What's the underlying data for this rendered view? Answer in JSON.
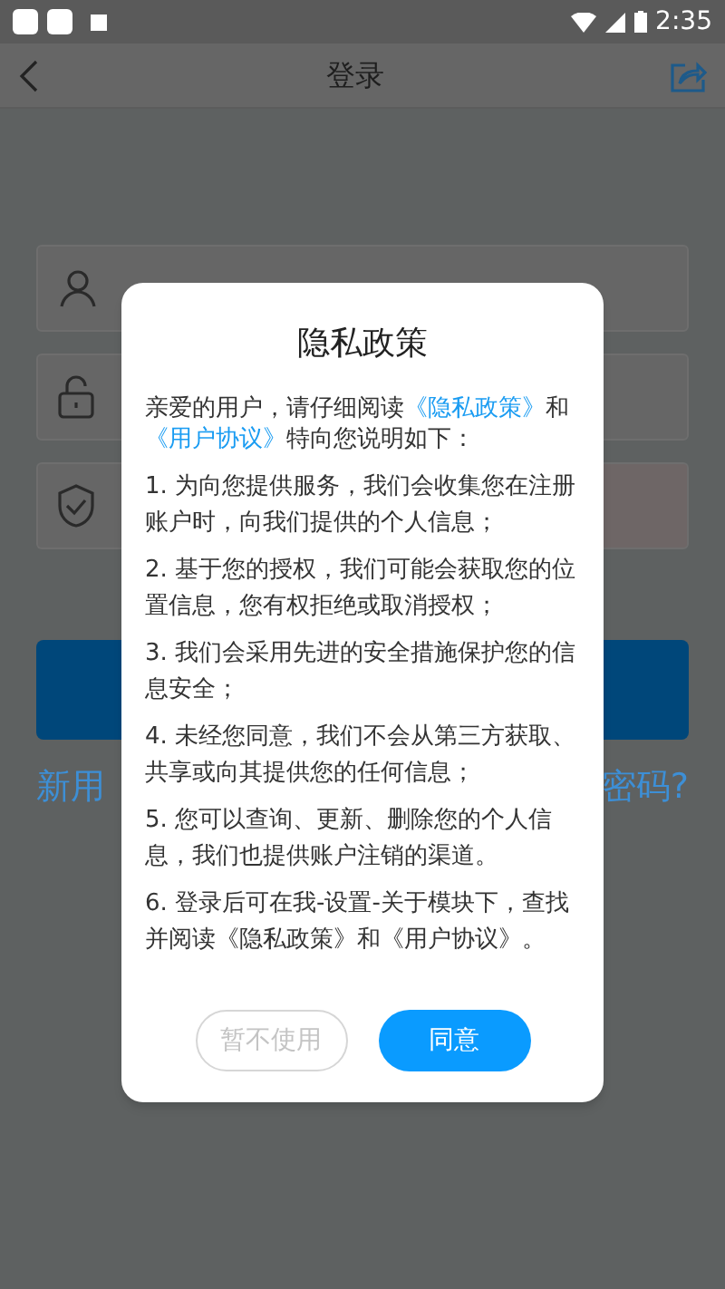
{
  "status_bar": {
    "time": "2:35"
  },
  "header": {
    "title": "登录"
  },
  "form": {
    "fields": [
      {
        "kind": "user"
      },
      {
        "kind": "lock"
      },
      {
        "kind": "captcha"
      }
    ],
    "links": [
      "新用",
      "密码?"
    ]
  },
  "dialog": {
    "title": "隐私政策",
    "intro": [
      {
        "text": "亲爱的用户，请仔细阅读",
        "link": false
      },
      {
        "text": "《隐私政策》",
        "link": true
      },
      {
        "text": "和",
        "link": false
      },
      {
        "text": "《用户协议》",
        "link": true
      },
      {
        "text": "特向您说明如下：",
        "link": false
      }
    ],
    "items": [
      "1. 为向您提供服务，我们会收集您在注册账户时，向我们提供的个人信息；",
      "2. 基于您的授权，我们可能会获取您的位置信息，您有权拒绝或取消授权；",
      "3. 我们会采用先进的安全措施保护您的信息安全；",
      "4. 未经您同意，我们不会从第三方获取、共享或向其提供您的任何信息；",
      "5. 您可以查询、更新、删除您的个人信息，我们也提供账户注销的渠道。",
      "6. 登录后可在我-设置-关于模块下，查找并阅读《隐私政策》和《用户协议》。"
    ],
    "buttons": [
      {
        "label": "暂不使用",
        "primary": false
      },
      {
        "label": "同意",
        "primary": true
      }
    ]
  }
}
